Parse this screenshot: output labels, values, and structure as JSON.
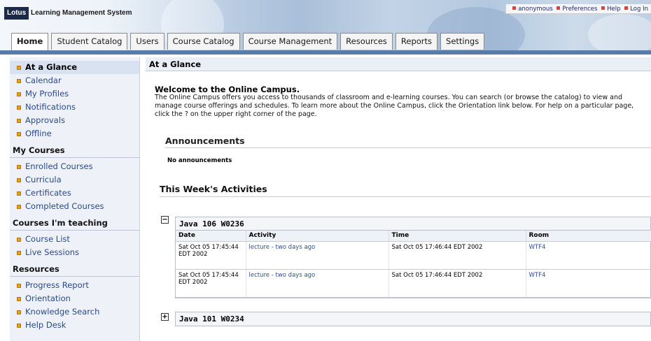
{
  "header": {
    "logo": "Lotus",
    "app_title": "Learning Management System",
    "top_links": [
      "anonymous",
      "Preferences",
      "Help",
      "Log In"
    ]
  },
  "tabs": [
    {
      "label": "Home",
      "active": true
    },
    {
      "label": "Student Catalog",
      "active": false
    },
    {
      "label": "Users",
      "active": false
    },
    {
      "label": "Course Catalog",
      "active": false
    },
    {
      "label": "Course Management",
      "active": false
    },
    {
      "label": "Resources",
      "active": false
    },
    {
      "label": "Reports",
      "active": false
    },
    {
      "label": "Settings",
      "active": false
    }
  ],
  "sidebar": {
    "items_top": [
      {
        "label": "At a Glance",
        "active": true
      },
      {
        "label": "Calendar"
      },
      {
        "label": "My Profiles"
      },
      {
        "label": "Notifications"
      },
      {
        "label": "Approvals"
      },
      {
        "label": "Offline"
      }
    ],
    "my_courses_heading": "My Courses",
    "my_courses": [
      "Enrolled Courses",
      "Curricula",
      "Certificates",
      "Completed Courses"
    ],
    "teaching_heading": "Courses I'm teaching",
    "teaching": [
      "Course List",
      "Live Sessions"
    ],
    "resources_heading": "Resources",
    "resources": [
      "Progress Report",
      "Orientation",
      "Knowledge Search",
      "Help Desk"
    ]
  },
  "main": {
    "page_title": "At a Glance",
    "welcome_title": "Welcome to the Online Campus.",
    "welcome_text": "The Online Campus offers you access to thousands of classroom and e-learning courses. You can search (or browse the catalog) to view and manage course offerings and schedules. To learn more about the Online Campus, click the Orientation link below. For help on a particular page, click the ? on the upper right corner of the page.",
    "announcements_title": "Announcements",
    "announcements_empty": "No announcements",
    "activities_title": "This Week's Activities",
    "courses": [
      {
        "name": "Java 106 W0236",
        "expanded": true,
        "toggle": "−",
        "columns": [
          "Date",
          "Activity",
          "Time",
          "Room"
        ],
        "rows": [
          {
            "date": "Sat Oct 05 17:45:44 EDT 2002",
            "activity": "lecture - two days ago",
            "time": "Sat Oct 05 17:46:44 EDT 2002",
            "room": "WTF4"
          },
          {
            "date": "Sat Oct 05 17:45:44 EDT 2002",
            "activity": "lecture - two days ago",
            "time": "Sat Oct 05 17:46:44 EDT 2002",
            "room": "WTF4"
          }
        ]
      },
      {
        "name": "Java 101 W0234",
        "expanded": false,
        "toggle": "+"
      }
    ]
  }
}
